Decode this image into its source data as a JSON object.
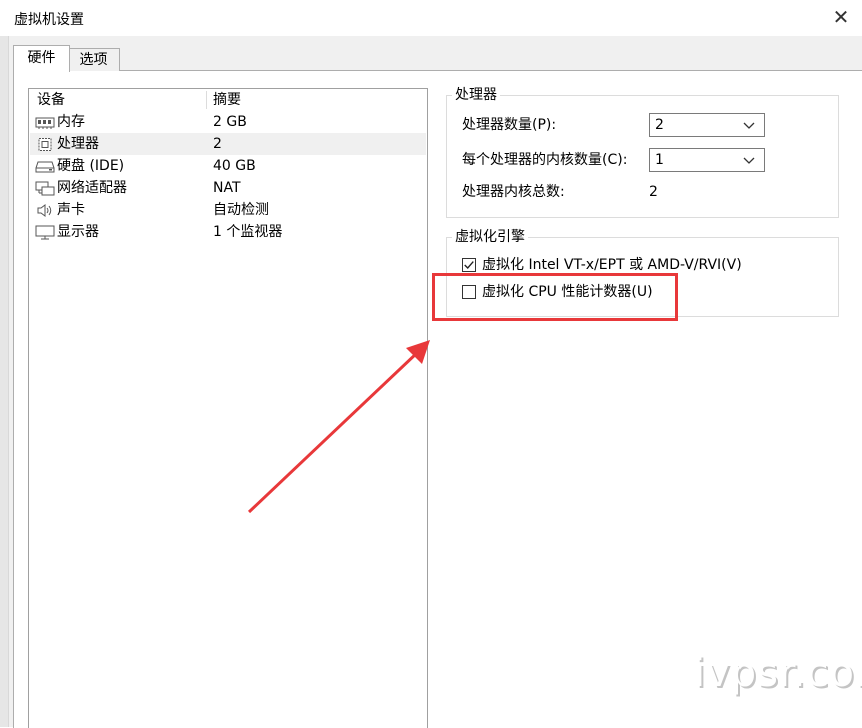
{
  "window": {
    "title": "虚拟机设置",
    "close_glyph": "✕"
  },
  "tabs": [
    {
      "label": "硬件",
      "active": true
    },
    {
      "label": "选项",
      "active": false
    }
  ],
  "device_list": {
    "columns": [
      "设备",
      "摘要"
    ],
    "rows": [
      {
        "icon": "memory-icon",
        "name": "内存",
        "summary": "2 GB"
      },
      {
        "icon": "processor-icon",
        "name": "处理器",
        "summary": "2",
        "selected": true
      },
      {
        "icon": "hard-disk-icon",
        "name": "硬盘 (IDE)",
        "summary": "40 GB"
      },
      {
        "icon": "network-adapter-icon",
        "name": "网络适配器",
        "summary": "NAT"
      },
      {
        "icon": "sound-card-icon",
        "name": "声卡",
        "summary": "自动检测"
      },
      {
        "icon": "display-icon",
        "name": "显示器",
        "summary": "1 个监视器"
      }
    ]
  },
  "processor_group": {
    "title": "处理器",
    "count_label": "处理器数量(P):",
    "count_value": "2",
    "cores_label": "每个处理器的内核数量(C):",
    "cores_value": "1",
    "total_label": "处理器内核总数:",
    "total_value": "2"
  },
  "virtualization_group": {
    "title": "虚拟化引擎",
    "vtx_label": "虚拟化 Intel VT-x/EPT 或 AMD-V/RVI(V)",
    "vtx_checked": true,
    "cpu_counters_label": "虚拟化 CPU 性能计数器(U)",
    "cpu_counters_checked": false
  },
  "annotation": {
    "highlight_color": "#e8383a"
  },
  "watermark": "ivpsr.com"
}
